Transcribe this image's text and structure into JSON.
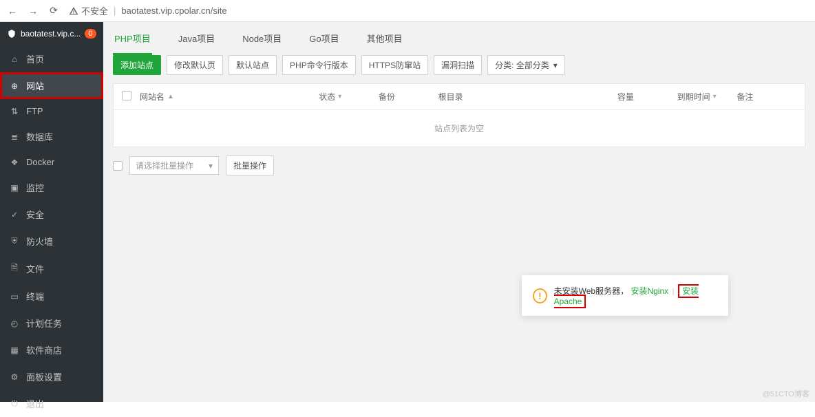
{
  "chrome": {
    "insecure_label": "不安全",
    "url": "baotatest.vip.cpolar.cn/site"
  },
  "brand": {
    "title": "baotatest.vip.c...",
    "badge": "0"
  },
  "sidebar": [
    {
      "id": "home",
      "label": "首页"
    },
    {
      "id": "site",
      "label": "网站"
    },
    {
      "id": "ftp",
      "label": "FTP"
    },
    {
      "id": "db",
      "label": "数据库"
    },
    {
      "id": "docker",
      "label": "Docker"
    },
    {
      "id": "monitor",
      "label": "监控"
    },
    {
      "id": "safe",
      "label": "安全"
    },
    {
      "id": "firewall",
      "label": "防火墙"
    },
    {
      "id": "files",
      "label": "文件"
    },
    {
      "id": "terminal",
      "label": "终端"
    },
    {
      "id": "cron",
      "label": "计划任务"
    },
    {
      "id": "store",
      "label": "软件商店"
    },
    {
      "id": "panel",
      "label": "面板设置"
    },
    {
      "id": "logout",
      "label": "退出"
    }
  ],
  "tabs": [
    {
      "id": "php",
      "label": "PHP项目"
    },
    {
      "id": "java",
      "label": "Java项目"
    },
    {
      "id": "node",
      "label": "Node项目"
    },
    {
      "id": "go",
      "label": "Go项目"
    },
    {
      "id": "other",
      "label": "其他项目"
    }
  ],
  "toolbar": {
    "add": "添加站点",
    "default_page": "修改默认页",
    "default_site": "默认站点",
    "php_cli": "PHP命令行版本",
    "https": "HTTPS防窜站",
    "scan": "漏洞扫描",
    "category": "分类: 全部分类"
  },
  "columns": {
    "name": "网站名",
    "status": "状态",
    "backup": "备份",
    "root": "根目录",
    "cap": "容量",
    "expire": "到期时间",
    "note": "备注"
  },
  "empty": "站点列表为空",
  "batch": {
    "placeholder": "请选择批量操作",
    "btn": "批量操作"
  },
  "popup": {
    "msg": "未安装Web服务器，",
    "nginx": "安装Nginx",
    "apache": "安装Apache"
  },
  "watermark": "@51CTO博客"
}
